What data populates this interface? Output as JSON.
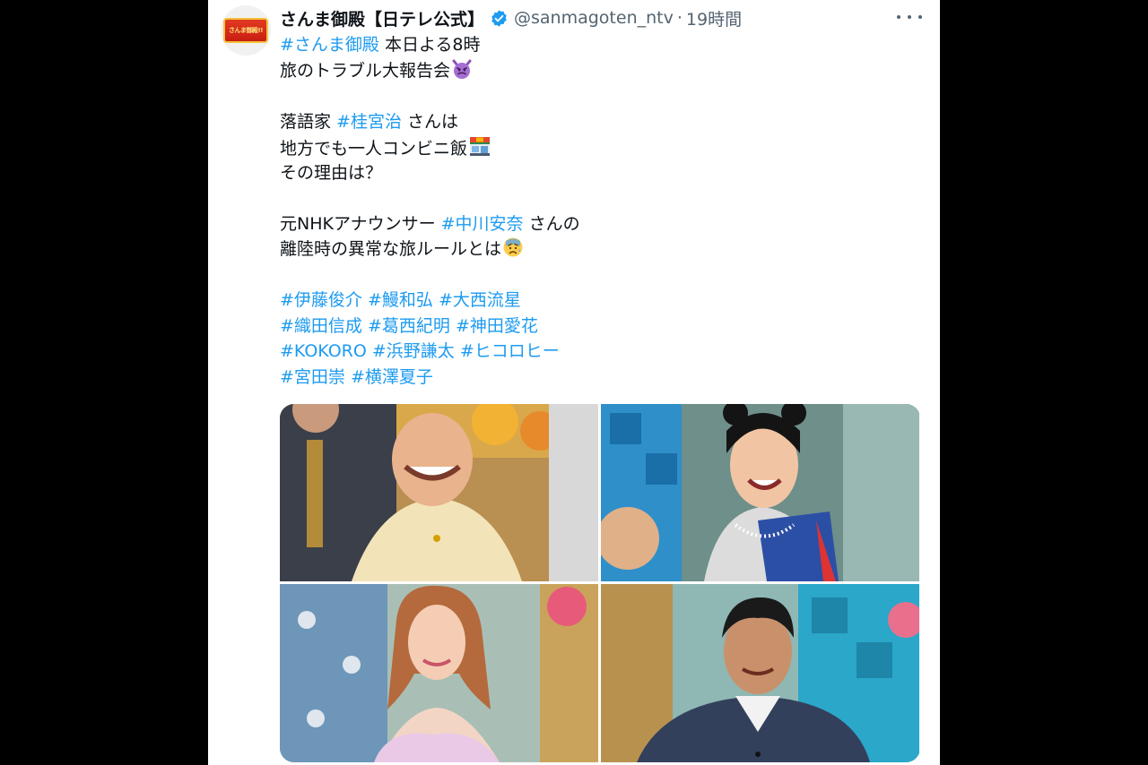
{
  "tweet": {
    "display_name": "さんま御殿【日テレ公式】",
    "handle": "@sanmagoten_ntv",
    "separator": "·",
    "timestamp": "19時間",
    "avatar_logo_text": "さんま御殿!!",
    "verified": true,
    "lines": [
      [
        {
          "t": "#さんま御殿",
          "tag": true
        },
        {
          "t": " 本日よる8時"
        }
      ],
      [
        {
          "t": "旅のトラブル大報告会"
        },
        {
          "emoji": "devil"
        }
      ],
      [],
      [
        {
          "t": "落語家 "
        },
        {
          "t": "#桂宮治",
          "tag": true
        },
        {
          "t": " さんは"
        }
      ],
      [
        {
          "t": "地方でも一人コンビニ飯"
        },
        {
          "emoji": "store"
        }
      ],
      [
        {
          "t": "その理由は？"
        }
      ],
      [],
      [
        {
          "t": "元NHKアナウンサー "
        },
        {
          "t": "#中川安奈",
          "tag": true
        },
        {
          "t": " さんの"
        }
      ],
      [
        {
          "t": "離陸時の異常な旅ルールとは"
        },
        {
          "emoji": "worried"
        }
      ],
      [],
      [
        {
          "t": "#伊藤俊介",
          "tag": true
        },
        {
          "t": " "
        },
        {
          "t": "#鰻和弘",
          "tag": true
        },
        {
          "t": " "
        },
        {
          "t": "#大西流星",
          "tag": true
        }
      ],
      [
        {
          "t": "#織田信成",
          "tag": true
        },
        {
          "t": " "
        },
        {
          "t": "#葛西紀明",
          "tag": true
        },
        {
          "t": " "
        },
        {
          "t": "#神田愛花",
          "tag": true
        }
      ],
      [
        {
          "t": "#KOKORO",
          "tag": true
        },
        {
          "t": " "
        },
        {
          "t": "#浜野謙太",
          "tag": true
        },
        {
          "t": " "
        },
        {
          "t": "#ヒコロヒー",
          "tag": true
        }
      ],
      [
        {
          "t": "#宮田崇",
          "tag": true
        },
        {
          "t": " "
        },
        {
          "t": "#横澤夏子",
          "tag": true
        }
      ]
    ],
    "emoji_icons": {
      "devil": "smiling-imp-icon",
      "store": "convenience-store-icon",
      "worried": "anxious-face-icon"
    },
    "media": [
      {
        "name": "photo-rakugo-performer",
        "bg": "#c9a86a",
        "accent": "#f3e3b8"
      },
      {
        "name": "photo-woman-basketball-jersey",
        "bg": "#4f8fa0",
        "accent": "#2c4fa6"
      },
      {
        "name": "photo-woman-pink-dress",
        "bg": "#8fb3b0",
        "accent": "#e9c9e6"
      },
      {
        "name": "photo-man-plaid-sweater",
        "bg": "#7fa8a8",
        "accent": "#33405c"
      }
    ]
  },
  "colors": {
    "link": "#1d9bf0",
    "text": "#0f1419",
    "muted": "#536471",
    "verified": "#1d9bf0",
    "page_bg": "#000000"
  }
}
